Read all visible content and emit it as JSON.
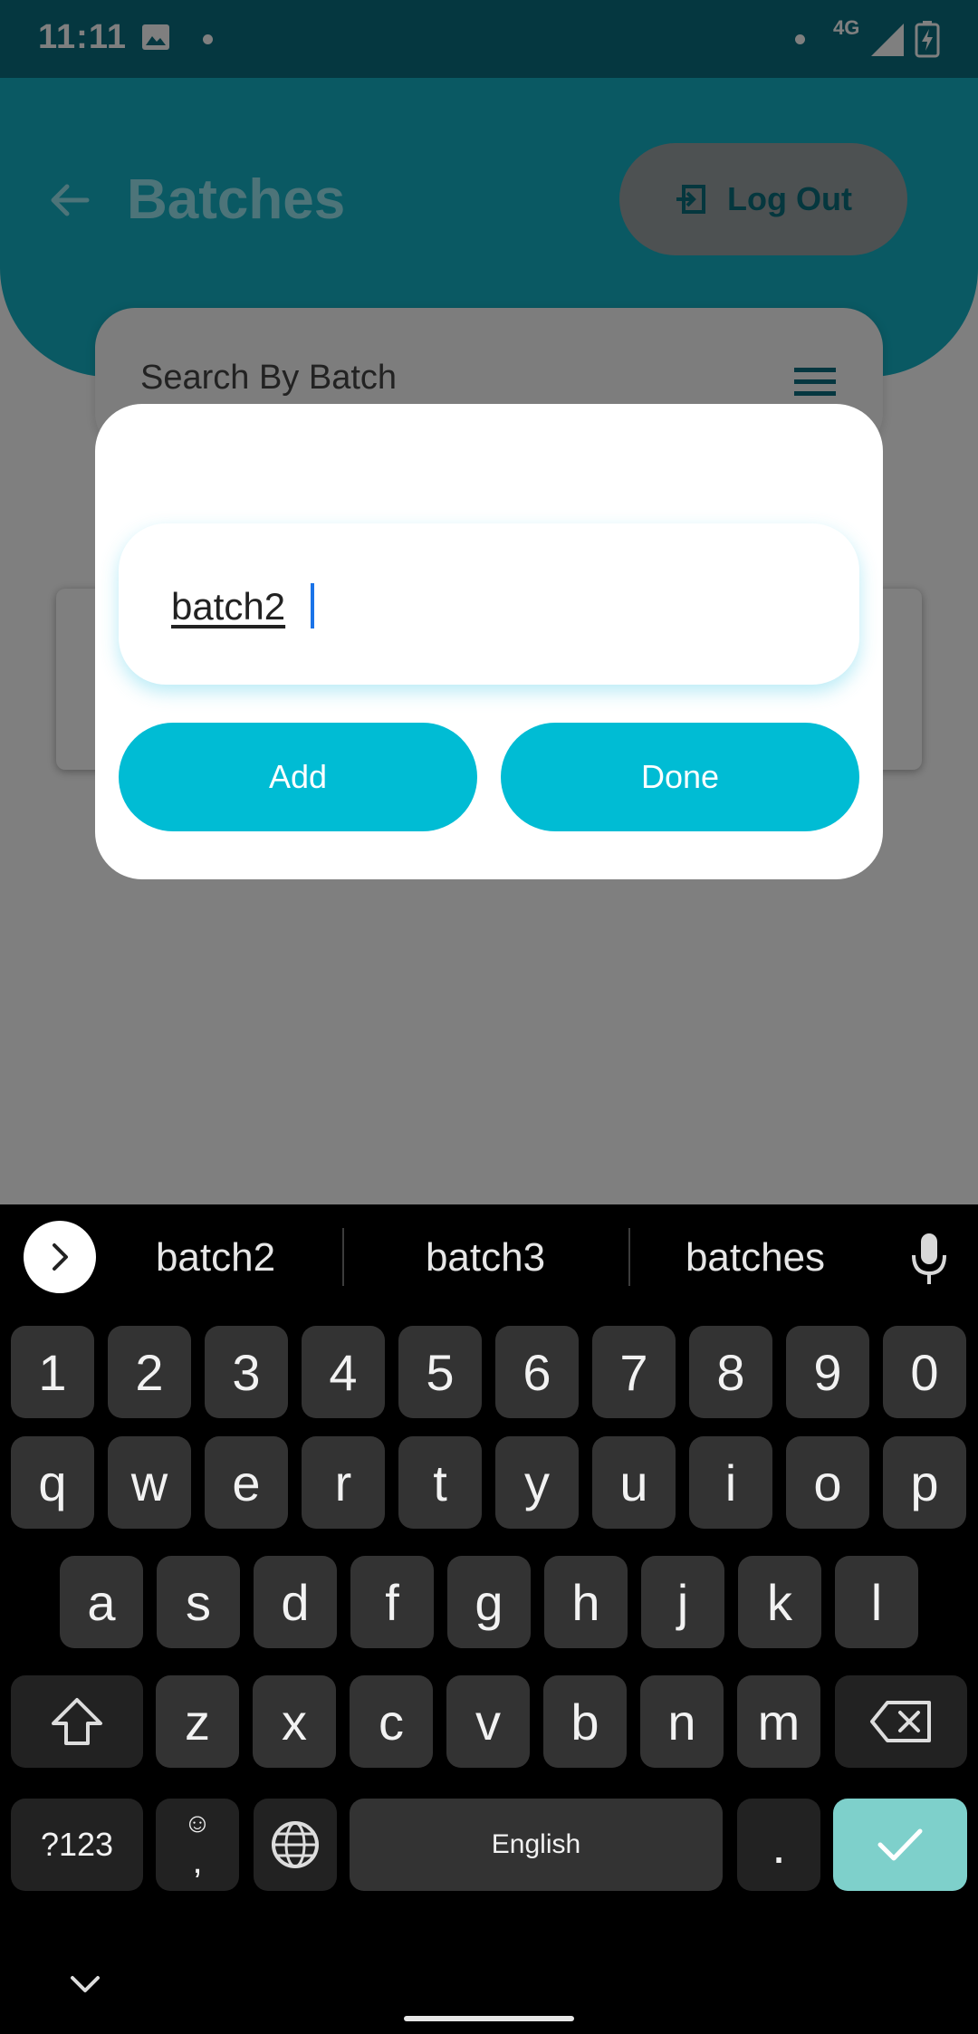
{
  "status_bar": {
    "time": "11:11",
    "network": "4G"
  },
  "header": {
    "title": "Batches",
    "logout_label": "Log Out"
  },
  "search": {
    "placeholder": "Search By Batch"
  },
  "dialog": {
    "input_value": "batch2",
    "add_label": "Add",
    "done_label": "Done"
  },
  "keyboard": {
    "suggestions": [
      "batch2",
      "batch3",
      "batches"
    ],
    "row_numbers": [
      "1",
      "2",
      "3",
      "4",
      "5",
      "6",
      "7",
      "8",
      "9",
      "0"
    ],
    "row_top": [
      "q",
      "w",
      "e",
      "r",
      "t",
      "y",
      "u",
      "i",
      "o",
      "p"
    ],
    "row_home": [
      "a",
      "s",
      "d",
      "f",
      "g",
      "h",
      "j",
      "k",
      "l"
    ],
    "row_bottom": [
      "z",
      "x",
      "c",
      "v",
      "b",
      "n",
      "m"
    ],
    "symbols_label": "?123",
    "comma_label": ",",
    "emoji_glyph": "☺",
    "space_label": "English",
    "period_label": "."
  },
  "colors": {
    "header": "#14b3c7",
    "status_bar": "#0a6f80",
    "button": "#00bcd4",
    "keyboard_bg": "#000000",
    "key": "#333333",
    "enter_key": "#7ed0cb"
  }
}
